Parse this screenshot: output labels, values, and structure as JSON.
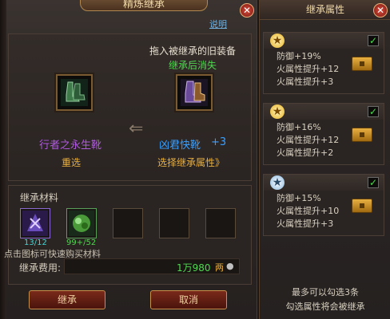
{
  "left": {
    "title": "精炼继承",
    "help": "说明",
    "instruction": "拖入被继承的旧装备",
    "note": "继承后消失",
    "source_item": {
      "name": "行者之永生靴",
      "action": "重选"
    },
    "target_item": {
      "name": "凶君快靴",
      "level": "+3",
      "action": "选择继承属性》"
    },
    "materials_label": "继承材料",
    "materials": [
      {
        "count": "13/12",
        "icon": "purple-crystal-icon"
      },
      {
        "count": "99+/52",
        "icon": "green-gem-icon"
      }
    ],
    "hint": "点击图标可快速购买材料",
    "fee_label": "继承费用:",
    "fee_value": "1万980",
    "fee_unit": "两",
    "buttons": {
      "inherit": "继承",
      "cancel": "取消"
    }
  },
  "right": {
    "title": "继承属性",
    "properties": [
      {
        "star": "gold",
        "lines": [
          "防御+19%",
          "火属性提升+12",
          "火属性提升+3"
        ],
        "checked": true
      },
      {
        "star": "gold",
        "lines": [
          "防御+16%",
          "火属性提升+12",
          "火属性提升+2"
        ],
        "checked": true
      },
      {
        "star": "silver",
        "lines": [
          "防御+15%",
          "火属性提升+10",
          "火属性提升+3"
        ],
        "checked": true
      }
    ],
    "footer": [
      "最多可以勾选3条",
      "勾选属性将会被继承"
    ]
  },
  "colors": {
    "purple_name": "#b05ae0",
    "blue_name": "#3aa0ff",
    "gold_text": "#e8b040",
    "green_text": "#4fd84f",
    "cyan_text": "#40d8d8"
  }
}
